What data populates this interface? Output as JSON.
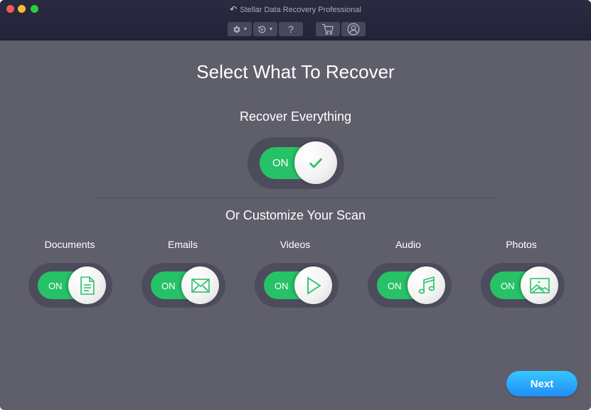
{
  "window": {
    "title": "Stellar Data Recovery Professional",
    "title_icon": "back-arrow-icon"
  },
  "toolbar": {
    "buttons": [
      {
        "name": "settings",
        "icon": "gear-icon",
        "has_dropdown": true
      },
      {
        "name": "history",
        "icon": "resume-recovery-icon",
        "has_dropdown": true
      },
      {
        "name": "help",
        "icon": "question-icon",
        "label": "?"
      },
      {
        "name": "cart",
        "icon": "cart-icon"
      },
      {
        "name": "account",
        "icon": "user-icon"
      }
    ]
  },
  "main": {
    "title": "Select What To Recover",
    "recover_everything": {
      "label": "Recover Everything",
      "state": "ON",
      "icon": "checkmark-icon"
    },
    "customize_title": "Or Customize Your Scan",
    "categories": [
      {
        "label": "Documents",
        "state": "ON",
        "icon": "document-icon"
      },
      {
        "label": "Emails",
        "state": "ON",
        "icon": "email-icon"
      },
      {
        "label": "Videos",
        "state": "ON",
        "icon": "play-icon"
      },
      {
        "label": "Audio",
        "state": "ON",
        "icon": "music-note-icon"
      },
      {
        "label": "Photos",
        "state": "ON",
        "icon": "image-icon"
      }
    ],
    "next_label": "Next"
  },
  "colors": {
    "accent_green": "#27c267",
    "next_blue": "#1f8ef7",
    "background": "#5f5e6b",
    "titlebar": "#24253b"
  }
}
